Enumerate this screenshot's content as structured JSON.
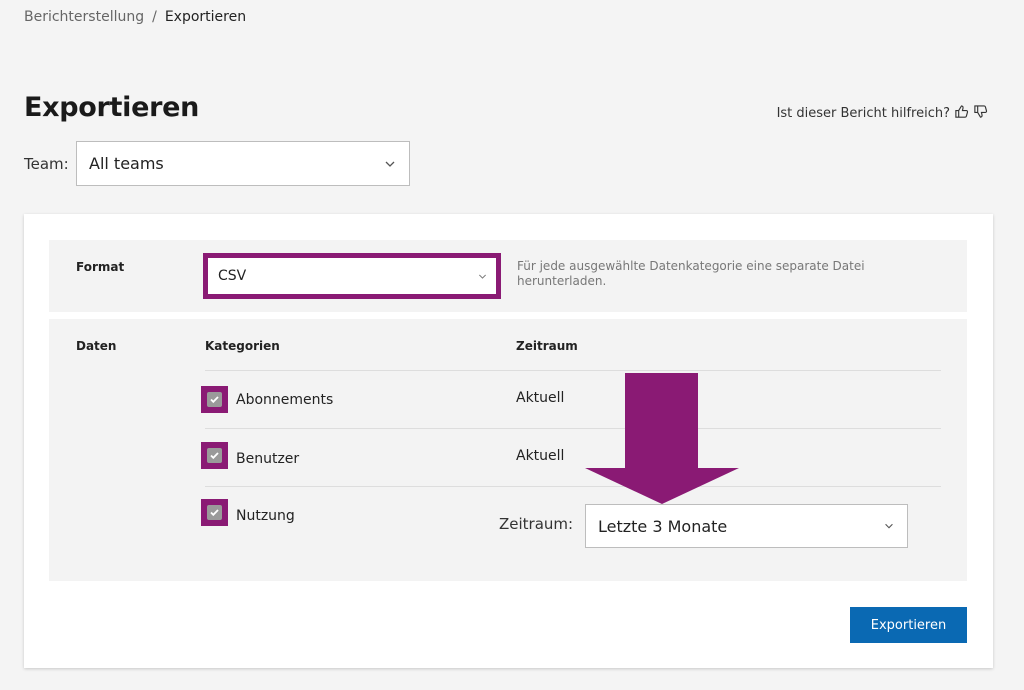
{
  "breadcrumb": {
    "parent": "Berichterstellung",
    "separator": "/",
    "current": "Exportieren"
  },
  "page_title": "Exportieren",
  "feedback": {
    "text": "Ist dieser Bericht hilfreich?",
    "icons": [
      "thumbs-up-icon",
      "thumbs-down-icon"
    ]
  },
  "team": {
    "label": "Team:",
    "selected": "All teams"
  },
  "format": {
    "label": "Format",
    "selected": "CSV",
    "hint": "Für jede ausgewählte Datenkategorie eine separate Datei herunterladen."
  },
  "daten": {
    "label": "Daten",
    "col_categories": "Kategorien",
    "col_period": "Zeitraum",
    "rows": [
      {
        "category": "Abonnements",
        "checked": true,
        "period": "Aktuell"
      },
      {
        "category": "Benutzer",
        "checked": true,
        "period": "Aktuell"
      },
      {
        "category": "Nutzung",
        "checked": true,
        "period": ""
      }
    ],
    "zeitraum_label": "Zeitraum:",
    "zeitraum_selected": "Letzte 3 Monate"
  },
  "export_button": "Exportieren",
  "colors": {
    "highlight": "#8a1a74",
    "primary_button": "#0a69b3",
    "background": "#f4f4f4"
  }
}
